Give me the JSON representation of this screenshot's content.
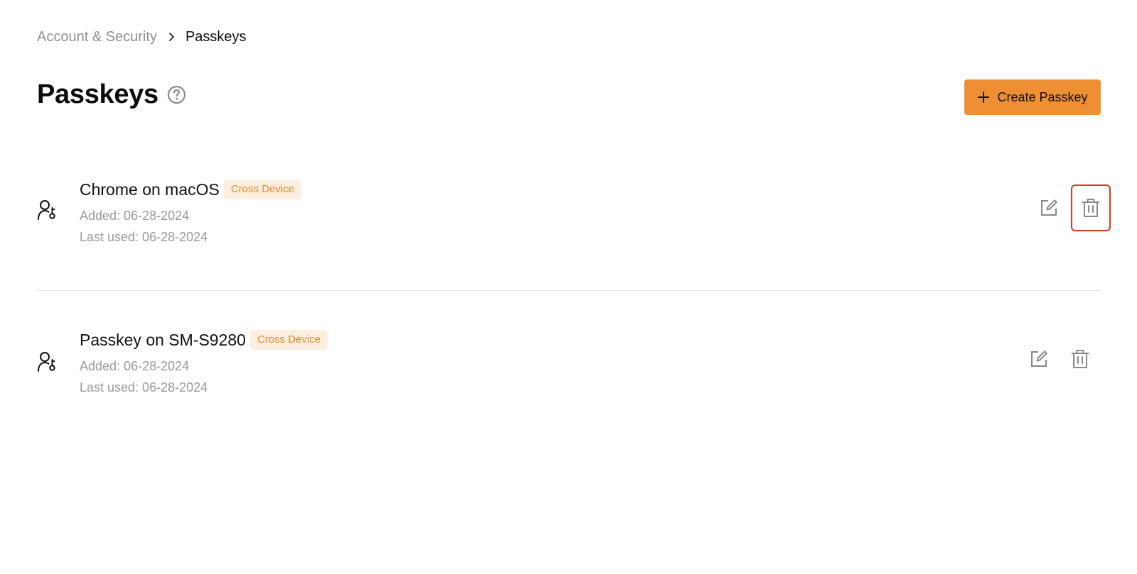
{
  "breadcrumb": {
    "parent": "Account & Security",
    "current": "Passkeys"
  },
  "header": {
    "title": "Passkeys",
    "create_label": "Create Passkey"
  },
  "passkeys": [
    {
      "name": "Chrome on macOS",
      "badge": "Cross Device",
      "added": "Added: 06-28-2024",
      "last_used": "Last used: 06-28-2024"
    },
    {
      "name": "Passkey on SM-S9280",
      "badge": "Cross Device",
      "added": "Added: 06-28-2024",
      "last_used": "Last used: 06-28-2024"
    }
  ],
  "icons": {
    "breadcrumb_separator": "chevron-right-icon",
    "help": "question-circle-icon",
    "create": "plus-icon",
    "passkey": "user-key-icon",
    "edit": "edit-icon",
    "delete": "trash-icon"
  },
  "colors": {
    "accent": "#ef8f34",
    "badge_bg": "#fdeee0",
    "badge_text": "#e98a2c",
    "highlight": "#e0391f",
    "muted_text": "#9a9a9a"
  }
}
